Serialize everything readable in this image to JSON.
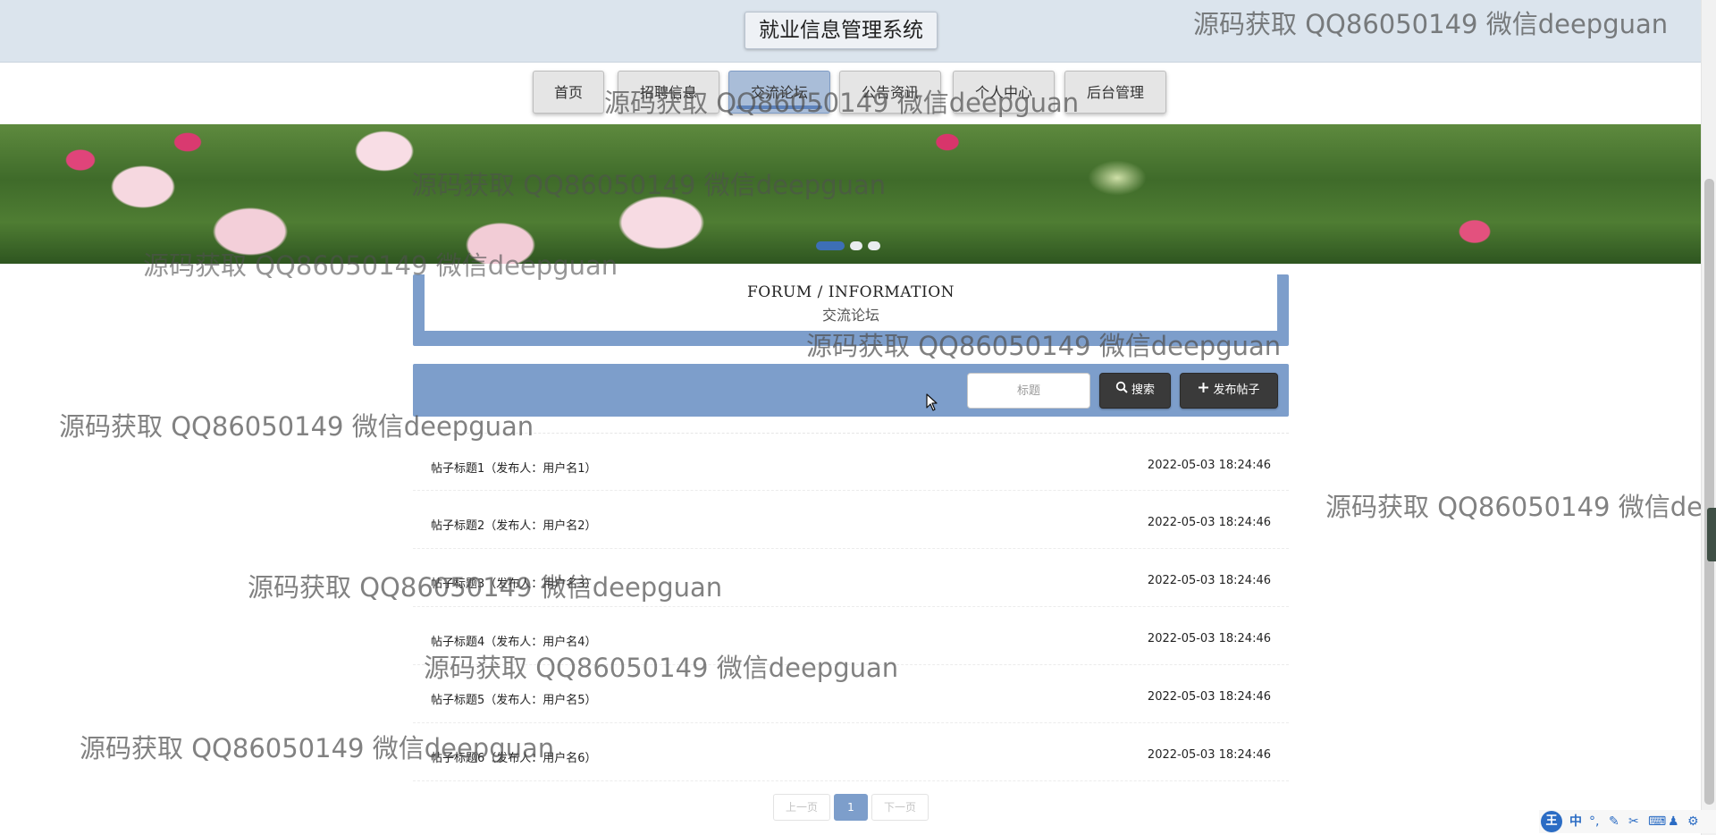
{
  "header": {
    "title": "就业信息管理系统"
  },
  "nav": {
    "items": [
      {
        "label": "首页",
        "active": false
      },
      {
        "label": "招聘信息",
        "active": false
      },
      {
        "label": "交流论坛",
        "active": true
      },
      {
        "label": "公告资讯",
        "active": false
      },
      {
        "label": "个人中心",
        "active": false
      },
      {
        "label": "后台管理",
        "active": false
      }
    ]
  },
  "banner": {
    "slide_count": 3,
    "active_slide": 1
  },
  "section": {
    "title_en": "FORUM / INFORMATION",
    "title_cn": "交流论坛"
  },
  "search": {
    "placeholder": "标题",
    "search_label": "搜索",
    "publish_label": "发布帖子"
  },
  "posts": [
    {
      "title": "帖子标题1（发布人：用户名1）",
      "time": "2022-05-03 18:24:46"
    },
    {
      "title": "帖子标题2（发布人：用户名2）",
      "time": "2022-05-03 18:24:46"
    },
    {
      "title": "帖子标题3（发布人：用户名3）",
      "time": "2022-05-03 18:24:46"
    },
    {
      "title": "帖子标题4（发布人：用户名4）",
      "time": "2022-05-03 18:24:46"
    },
    {
      "title": "帖子标题5（发布人：用户名5）",
      "time": "2022-05-03 18:24:46"
    },
    {
      "title": "帖子标题6（发布人：用户名6）",
      "time": "2022-05-03 18:24:46"
    }
  ],
  "pagination": {
    "prev_label": "上一页",
    "current_page": "1",
    "next_label": "下一页"
  },
  "watermark": "源码获取 QQ86050149 微信deepguan",
  "watermark_partial": "源码获取 QQ86050149 微信de",
  "ime": {
    "logo": "王",
    "lang": "中"
  },
  "colors": {
    "accent": "#7d9ecb",
    "header_bg": "#dbe4ed",
    "dark_button": "#3a3a3a"
  }
}
